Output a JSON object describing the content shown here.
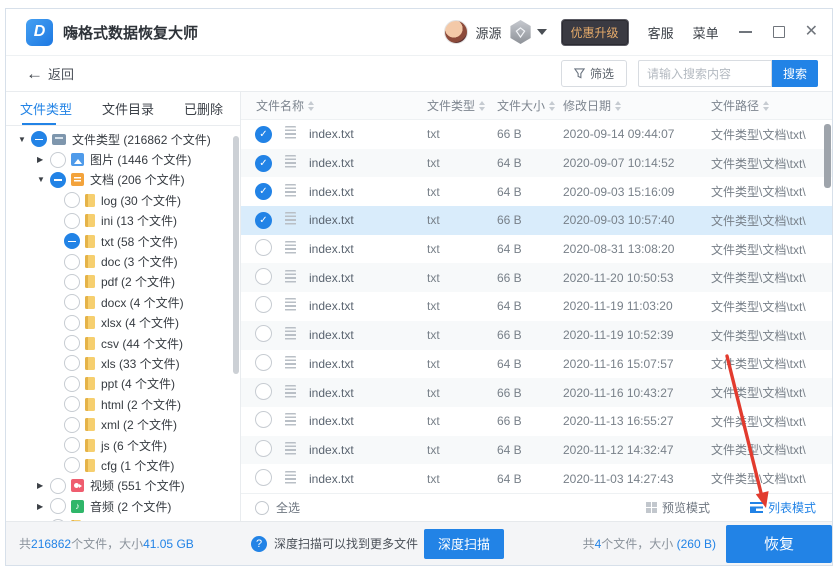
{
  "titlebar": {
    "app_title": "嗨格式数据恢复大师",
    "username": "源源",
    "upgrade_label": "优惠升级",
    "support_label": "客服",
    "menu_label": "菜单"
  },
  "toolbar": {
    "back_label": "返回",
    "filter_label": "筛选",
    "search_placeholder": "请输入搜索内容",
    "search_button": "搜索"
  },
  "sidebar": {
    "tabs": [
      {
        "label": "文件类型",
        "active": true
      },
      {
        "label": "文件目录",
        "active": false
      },
      {
        "label": "已删除",
        "active": false
      }
    ],
    "tree": [
      {
        "level": 0,
        "arrow": "down",
        "check": "partial",
        "icon": "computer",
        "label": "文件类型 (216862 个文件)"
      },
      {
        "level": 1,
        "arrow": "right",
        "check": "none",
        "icon": "image",
        "label": "图片 (1446 个文件)"
      },
      {
        "level": 1,
        "arrow": "down",
        "check": "partial",
        "icon": "doc",
        "label": "文档 (206 个文件)"
      },
      {
        "level": 2,
        "arrow": null,
        "check": "none",
        "icon": "file",
        "label": "log (30 个文件)"
      },
      {
        "level": 2,
        "arrow": null,
        "check": "none",
        "icon": "file",
        "label": "ini (13 个文件)"
      },
      {
        "level": 2,
        "arrow": null,
        "check": "partial",
        "icon": "file",
        "label": "txt (58 个文件)"
      },
      {
        "level": 2,
        "arrow": null,
        "check": "none",
        "icon": "file",
        "label": "doc (3 个文件)"
      },
      {
        "level": 2,
        "arrow": null,
        "check": "none",
        "icon": "file",
        "label": "pdf (2 个文件)"
      },
      {
        "level": 2,
        "arrow": null,
        "check": "none",
        "icon": "file",
        "label": "docx (4 个文件)"
      },
      {
        "level": 2,
        "arrow": null,
        "check": "none",
        "icon": "file",
        "label": "xlsx (4 个文件)"
      },
      {
        "level": 2,
        "arrow": null,
        "check": "none",
        "icon": "file",
        "label": "csv (44 个文件)"
      },
      {
        "level": 2,
        "arrow": null,
        "check": "none",
        "icon": "file",
        "label": "xls (33 个文件)"
      },
      {
        "level": 2,
        "arrow": null,
        "check": "none",
        "icon": "file",
        "label": "ppt (4 个文件)"
      },
      {
        "level": 2,
        "arrow": null,
        "check": "none",
        "icon": "file",
        "label": "html (2 个文件)"
      },
      {
        "level": 2,
        "arrow": null,
        "check": "none",
        "icon": "file",
        "label": "xml (2 个文件)"
      },
      {
        "level": 2,
        "arrow": null,
        "check": "none",
        "icon": "file",
        "label": "js (6 个文件)"
      },
      {
        "level": 2,
        "arrow": null,
        "check": "none",
        "icon": "file",
        "label": "cfg (1 个文件)"
      },
      {
        "level": 1,
        "arrow": "right",
        "check": "none",
        "icon": "video",
        "label": "视频 (551 个文件)"
      },
      {
        "level": 1,
        "arrow": "right",
        "check": "none",
        "icon": "audio",
        "label": "音频 (2 个文件)"
      },
      {
        "level": 1,
        "arrow": "right",
        "check": "none",
        "icon": "file",
        "label": ""
      }
    ]
  },
  "table": {
    "columns": [
      "文件名称",
      "文件类型",
      "文件大小",
      "修改日期",
      "文件路径"
    ],
    "rows": [
      {
        "checked": true,
        "selected": false,
        "name": "index.txt",
        "type": "txt",
        "size": "66 B",
        "date": "2020-09-14 09:44:07",
        "path": "文件类型\\文档\\txt\\"
      },
      {
        "checked": true,
        "selected": false,
        "name": "index.txt",
        "type": "txt",
        "size": "64 B",
        "date": "2020-09-07 10:14:52",
        "path": "文件类型\\文档\\txt\\"
      },
      {
        "checked": true,
        "selected": false,
        "name": "index.txt",
        "type": "txt",
        "size": "64 B",
        "date": "2020-09-03 15:16:09",
        "path": "文件类型\\文档\\txt\\"
      },
      {
        "checked": true,
        "selected": true,
        "name": "index.txt",
        "type": "txt",
        "size": "66 B",
        "date": "2020-09-03 10:57:40",
        "path": "文件类型\\文档\\txt\\"
      },
      {
        "checked": false,
        "selected": false,
        "name": "index.txt",
        "type": "txt",
        "size": "64 B",
        "date": "2020-08-31 13:08:20",
        "path": "文件类型\\文档\\txt\\"
      },
      {
        "checked": false,
        "selected": false,
        "name": "index.txt",
        "type": "txt",
        "size": "66 B",
        "date": "2020-11-20 10:50:53",
        "path": "文件类型\\文档\\txt\\"
      },
      {
        "checked": false,
        "selected": false,
        "name": "index.txt",
        "type": "txt",
        "size": "64 B",
        "date": "2020-11-19 11:03:20",
        "path": "文件类型\\文档\\txt\\"
      },
      {
        "checked": false,
        "selected": false,
        "name": "index.txt",
        "type": "txt",
        "size": "66 B",
        "date": "2020-11-19 10:52:39",
        "path": "文件类型\\文档\\txt\\"
      },
      {
        "checked": false,
        "selected": false,
        "name": "index.txt",
        "type": "txt",
        "size": "64 B",
        "date": "2020-11-16 15:07:57",
        "path": "文件类型\\文档\\txt\\"
      },
      {
        "checked": false,
        "selected": false,
        "name": "index.txt",
        "type": "txt",
        "size": "66 B",
        "date": "2020-11-16 10:43:27",
        "path": "文件类型\\文档\\txt\\"
      },
      {
        "checked": false,
        "selected": false,
        "name": "index.txt",
        "type": "txt",
        "size": "66 B",
        "date": "2020-11-13 16:55:27",
        "path": "文件类型\\文档\\txt\\"
      },
      {
        "checked": false,
        "selected": false,
        "name": "index.txt",
        "type": "txt",
        "size": "64 B",
        "date": "2020-11-12 14:32:47",
        "path": "文件类型\\文档\\txt\\"
      },
      {
        "checked": false,
        "selected": false,
        "name": "index.txt",
        "type": "txt",
        "size": "64 B",
        "date": "2020-11-03 14:27:43",
        "path": "文件类型\\文档\\txt\\"
      }
    ]
  },
  "footer": {
    "select_all": "全选",
    "preview_mode": "预览模式",
    "list_mode": "列表模式"
  },
  "bottombar": {
    "total_prefix": "共",
    "total_count": "216862",
    "total_mid": "个文件，大小",
    "total_size": "41.05 GB",
    "deep_scan_tip": "深度扫描可以找到更多文件",
    "deep_scan_button": "深度扫描",
    "selected_prefix": "共",
    "selected_count": "4",
    "selected_mid": "个文件，大小 ",
    "selected_size": "(260 B)",
    "recover_button": "恢复"
  },
  "colors": {
    "accent": "#2283e6",
    "selected_row": "#d9ecfb",
    "upgrade_bg": "#3a3a42",
    "upgrade_text": "#e5aa6a",
    "annotation_arrow": "#e23b2e"
  }
}
